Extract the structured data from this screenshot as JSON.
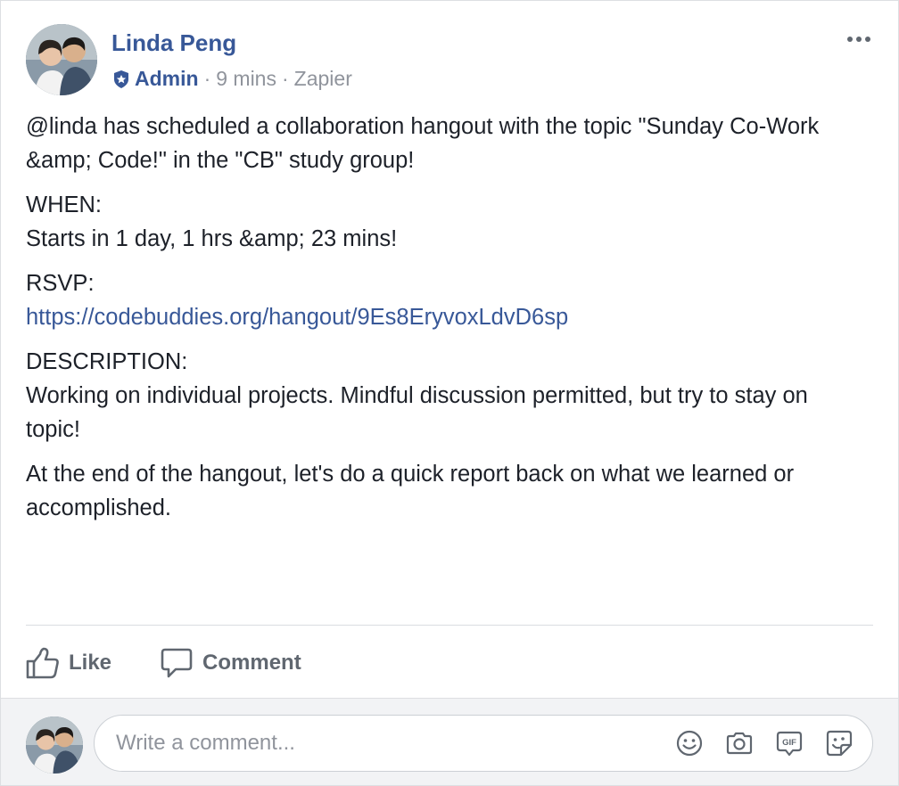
{
  "post": {
    "author": "Linda Peng",
    "badge": "Admin",
    "time": "9 mins",
    "source": "Zapier",
    "separator": "·"
  },
  "content": {
    "intro": "@linda has scheduled a collaboration hangout with the topic \"Sunday Co-Work &amp; Code!\" in the \"CB\" study group!",
    "when_label": "WHEN:",
    "when_value": "Starts in 1 day, 1 hrs &amp; 23 mins!",
    "rsvp_label": "RSVP:",
    "rsvp_link": "https://codebuddies.org/hangout/9Es8EryvoxLdvD6sp",
    "description_label": "DESCRIPTION:",
    "description_line1": "Working on individual projects. Mindful discussion permitted, but try to stay on",
    "description_line2": "topic!",
    "closing_line1": "At the end of the hangout, let's do a quick report back on what we learned or",
    "closing_line2": "accomplished."
  },
  "actions": {
    "like_label": "Like",
    "comment_label": "Comment"
  },
  "comment_box": {
    "placeholder": "Write a comment..."
  },
  "icons": {
    "more": "more-options-icon",
    "admin": "admin-badge-icon",
    "like": "thumbs-up-icon",
    "comment": "comment-bubble-icon",
    "emoji": "emoji-icon",
    "camera": "camera-icon",
    "gif": "gif-icon",
    "sticker": "sticker-icon"
  },
  "colors": {
    "link": "#385898",
    "muted": "#90949c",
    "text": "#1d2129",
    "action": "#606770"
  }
}
